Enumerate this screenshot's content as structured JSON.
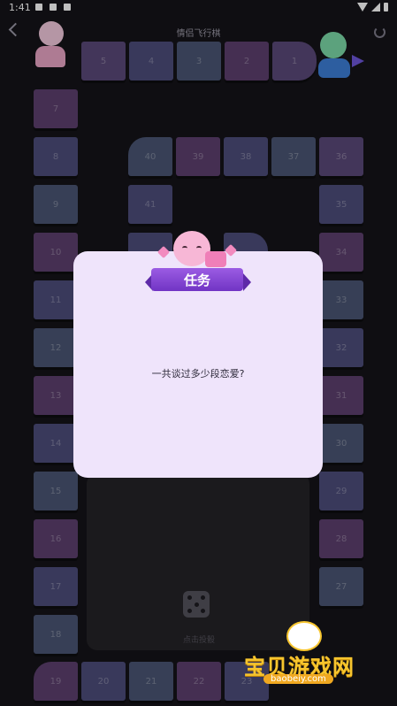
{
  "status_bar": {
    "time": "1:41"
  },
  "header": {
    "title": "情侣飞行棋"
  },
  "board": {
    "tiles": [
      {
        "label": "5",
        "color": "c1"
      },
      {
        "label": "4",
        "color": "c2"
      },
      {
        "label": "3",
        "color": "c4"
      },
      {
        "label": "2",
        "color": "c3"
      },
      {
        "label": "1",
        "color": "c1"
      },
      {
        "label": "7",
        "color": "c3"
      },
      {
        "label": "8",
        "color": "c2"
      },
      {
        "label": "9",
        "color": "c4"
      },
      {
        "label": "10",
        "color": "c3"
      },
      {
        "label": "11",
        "color": "c2"
      },
      {
        "label": "12",
        "color": "c4"
      },
      {
        "label": "13",
        "color": "c3"
      },
      {
        "label": "14",
        "color": "c2"
      },
      {
        "label": "15",
        "color": "c4"
      },
      {
        "label": "16",
        "color": "c3"
      },
      {
        "label": "17",
        "color": "c2"
      },
      {
        "label": "18",
        "color": "c4"
      },
      {
        "label": "19",
        "color": "c3"
      },
      {
        "label": "20",
        "color": "c2"
      },
      {
        "label": "21",
        "color": "c4"
      },
      {
        "label": "22",
        "color": "c3"
      },
      {
        "label": "23",
        "color": "c2"
      },
      {
        "label": "28",
        "color": "c3"
      },
      {
        "label": "27",
        "color": "c4"
      },
      {
        "label": "29",
        "color": "c2"
      },
      {
        "label": "30",
        "color": "c4"
      },
      {
        "label": "31",
        "color": "c3"
      },
      {
        "label": "32",
        "color": "c2"
      },
      {
        "label": "33",
        "color": "c4"
      },
      {
        "label": "34",
        "color": "c3"
      },
      {
        "label": "35",
        "color": "c2"
      },
      {
        "label": "36",
        "color": "c1"
      },
      {
        "label": "37",
        "color": "c4"
      },
      {
        "label": "38",
        "color": "c2"
      },
      {
        "label": "39",
        "color": "c3"
      },
      {
        "label": "40",
        "color": "c4"
      },
      {
        "label": "41",
        "color": "c2"
      }
    ]
  },
  "dice": {
    "label": "点击投骰"
  },
  "task_modal": {
    "title": "任务",
    "question": "一共谈过多少段恋爱?"
  },
  "watermark": {
    "name": "宝贝游戏网",
    "url": "baobeiy.com"
  }
}
